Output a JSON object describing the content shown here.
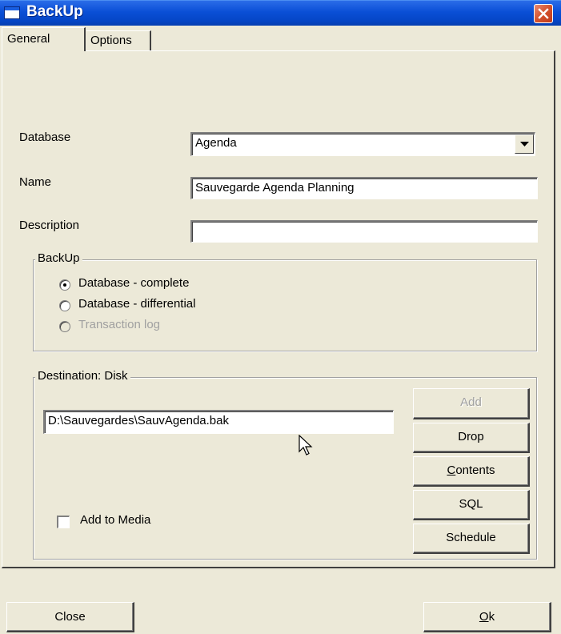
{
  "window": {
    "title": "BackUp"
  },
  "tabs": [
    {
      "label": "General",
      "selected": true
    },
    {
      "label": "Options",
      "selected": false
    }
  ],
  "form": {
    "database": {
      "label": "Database",
      "value": "Agenda"
    },
    "name": {
      "label": "Name",
      "value": "Sauvegarde Agenda Planning"
    },
    "description": {
      "label": "Description",
      "value": ""
    }
  },
  "backup_group": {
    "legend": "BackUp",
    "options": [
      {
        "label": "Database - complete",
        "checked": true,
        "enabled": true
      },
      {
        "label": "Database - differential",
        "checked": false,
        "enabled": true
      },
      {
        "label": "Transaction log",
        "checked": false,
        "enabled": false
      }
    ]
  },
  "destination_group": {
    "legend": "Destination: Disk",
    "path": "D:\\Sauvegardes\\SauvAgenda.bak",
    "add_to_media": {
      "label": "Add to Media",
      "checked": false
    }
  },
  "side_buttons": {
    "add": "Add",
    "drop": "Drop",
    "contents_accel": "C",
    "contents_rest": "ontents",
    "sql": "SQL",
    "schedule": "Schedule"
  },
  "footer": {
    "close": "Close",
    "ok_accel": "O",
    "ok_rest": "k"
  },
  "icons": {
    "close": "close-icon",
    "dropdown": "chevron-down-icon",
    "window": "window-icon",
    "cursor": "mouse-pointer-icon"
  },
  "colors": {
    "titlebar": "#0a4fd6",
    "close_button": "#d3522d",
    "face": "#ece9d8"
  }
}
